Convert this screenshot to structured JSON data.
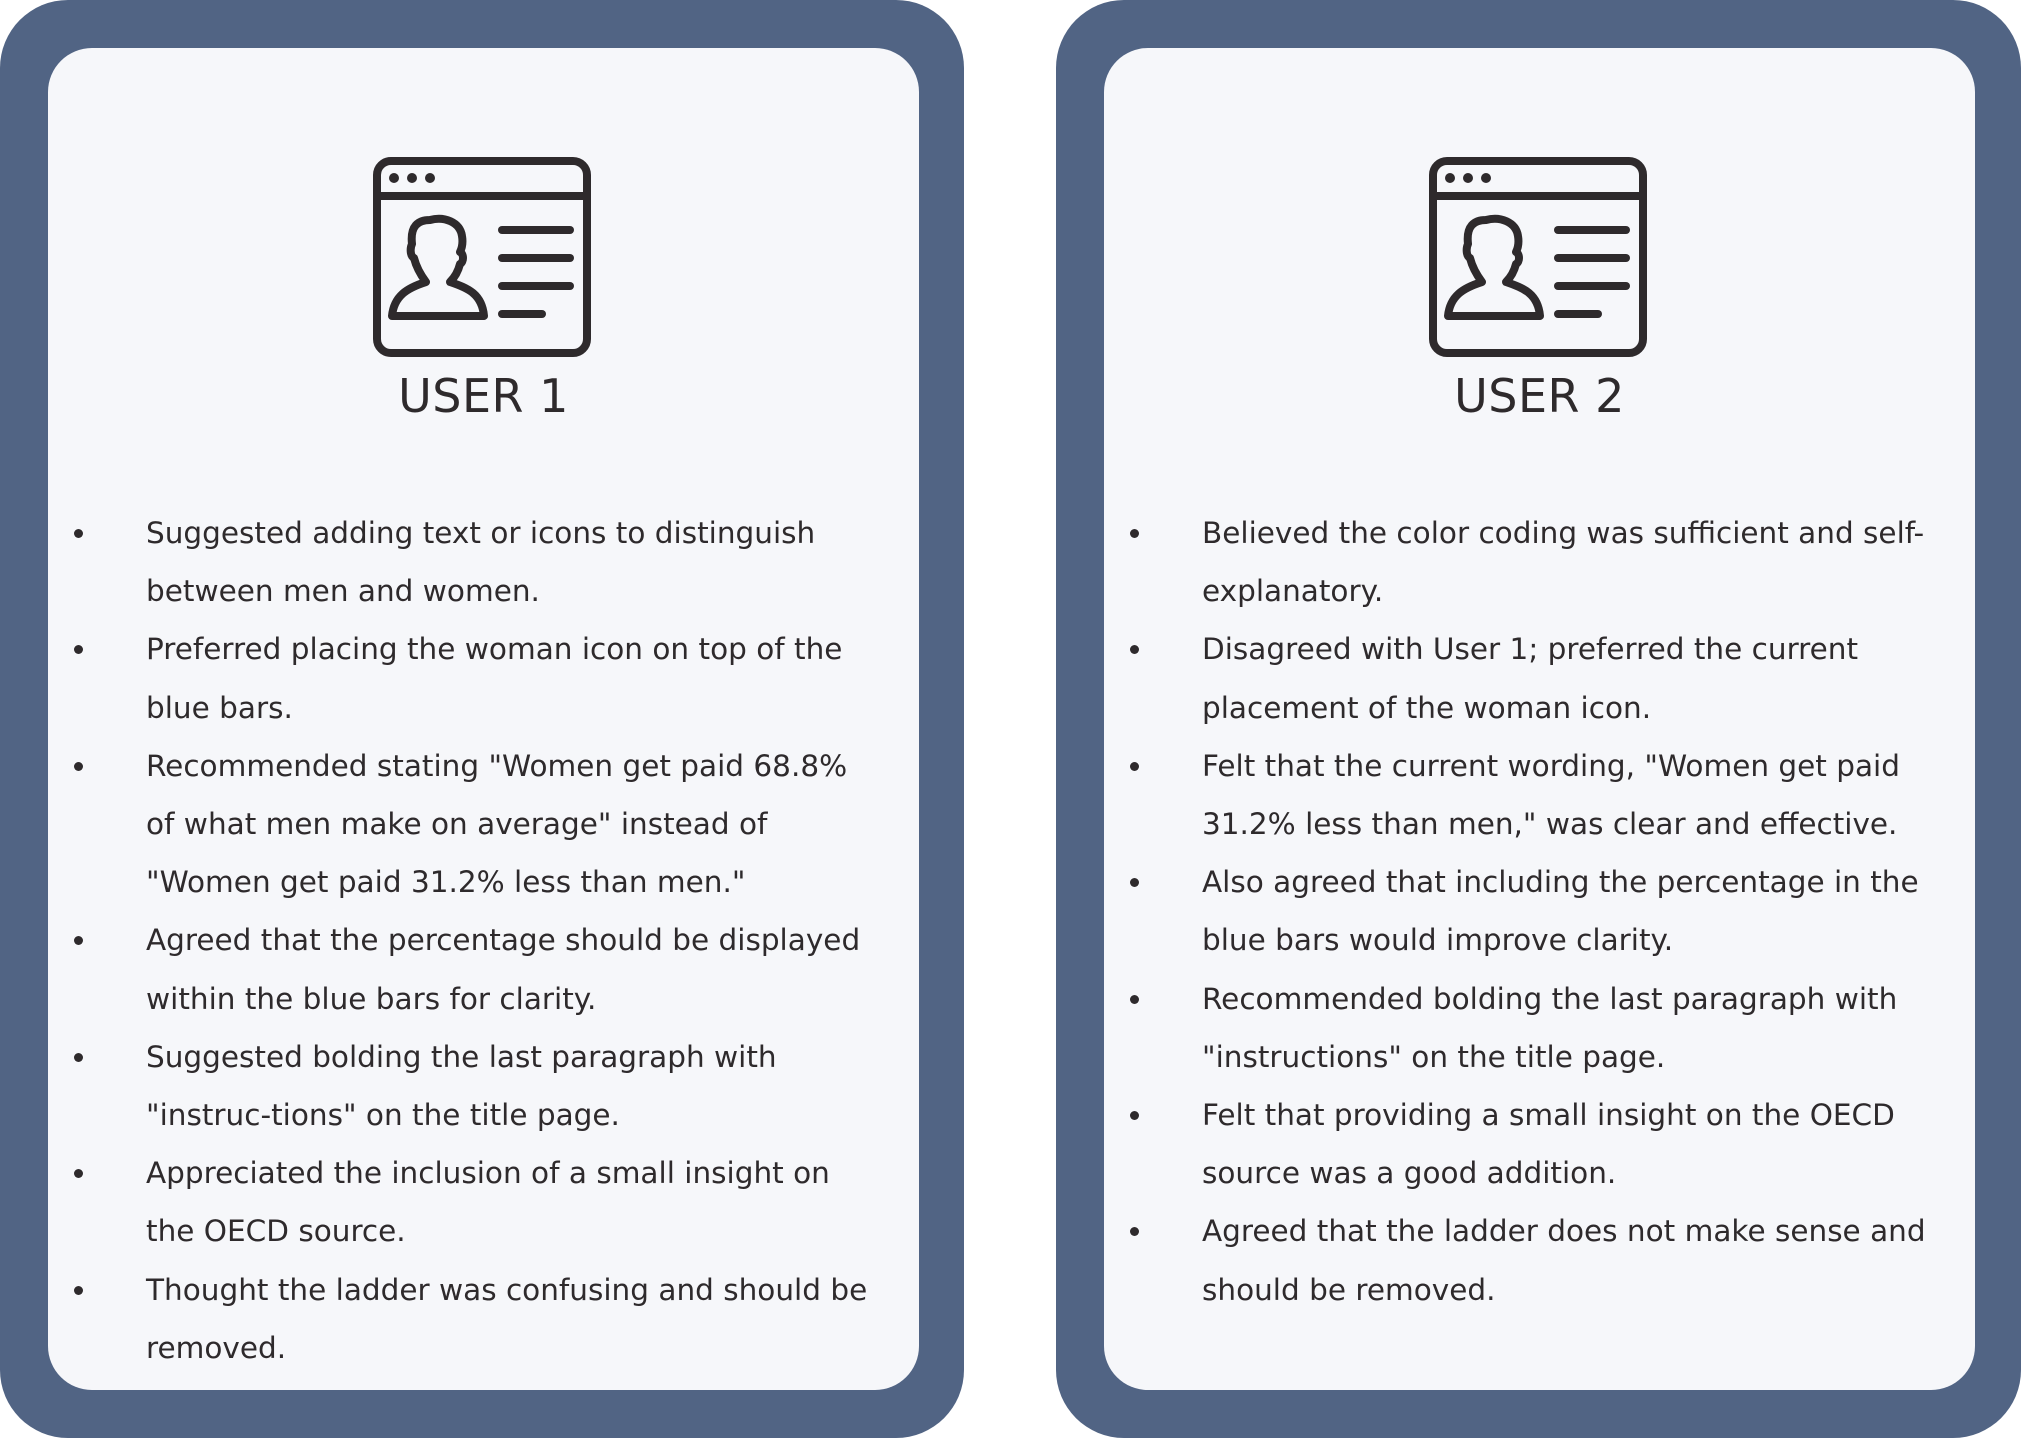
{
  "cards": [
    {
      "icon": "user-profile-window-icon",
      "title": "USER 1",
      "items": [
        "Suggested adding text or icons to distinguish between men and women.",
        "Preferred placing the woman icon on top of the blue bars.",
        "Recommended stating \"Women get paid 68.8% of what men make on average\" instead of \"Women get paid 31.2% less than men.\"",
        "Agreed that the percentage should be displayed within the blue bars for clarity.",
        "Suggested bolding the last paragraph with \"instruc-tions\" on the title page.",
        "Appreciated the inclusion of a small insight on the OECD source.",
        "Thought the ladder was confusing and should be removed."
      ]
    },
    {
      "icon": "user-profile-window-icon",
      "title": "USER 2",
      "items": [
        "Believed the color coding was sufficient and self-explanatory.",
        "Disagreed with User 1; preferred the current placement of the woman icon.",
        "Felt that the current wording, \"Women get paid 31.2% less than men,\" was clear and effective.",
        "Also agreed that including the percentage in the blue bars would improve clarity.",
        "Recommended bolding the last paragraph with \"instructions\" on the title page.",
        "Felt that providing a small insight on the OECD source was a good addition.",
        "Agreed that the ladder does not make sense and should be removed."
      ]
    }
  ],
  "colors": {
    "frame": "#516484",
    "panel": "#f6f7fa",
    "text": "#2e2a2c"
  }
}
